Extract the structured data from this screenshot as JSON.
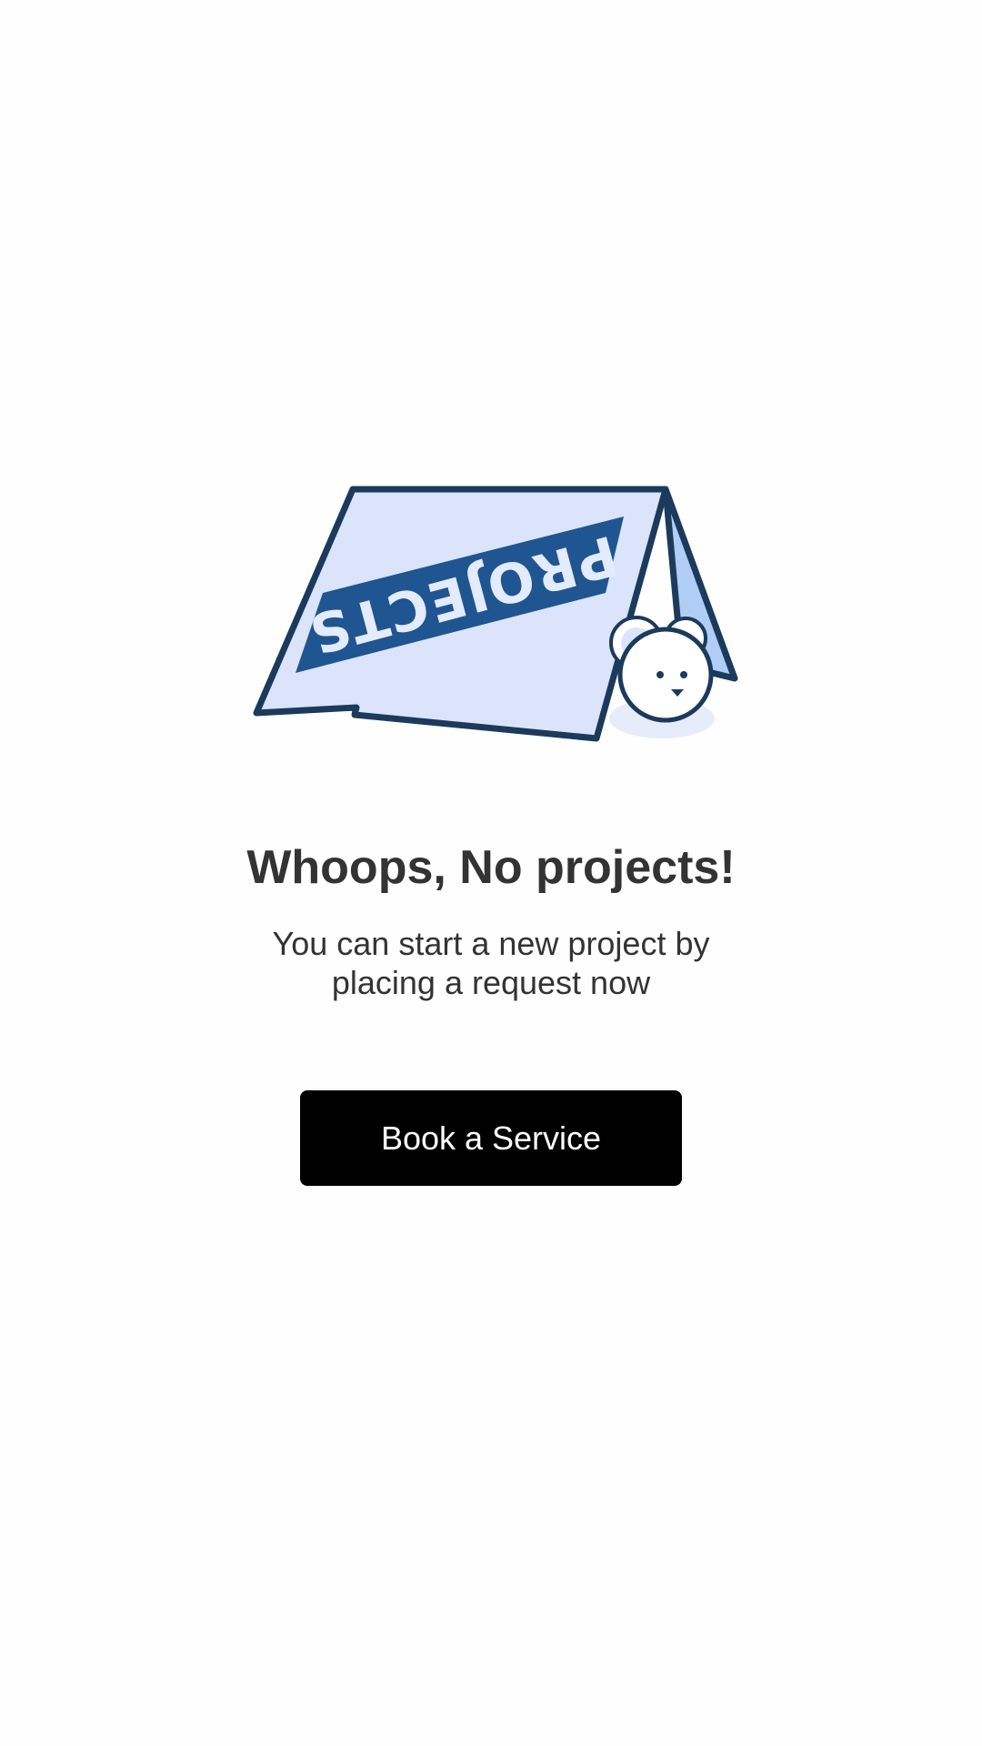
{
  "empty_state": {
    "illustration": {
      "icon": "projects-tent-illustration",
      "sign_text": "PROJECTS",
      "mascot_icon": "mouse-mascot-icon"
    },
    "title": "Whoops, No projects!",
    "subtitle_line1": "You can start a new project by",
    "subtitle_line2": "placing a request now",
    "button_label": "Book a Service"
  },
  "colors": {
    "background": "#fefefe",
    "text": "#333333",
    "button_bg": "#000000",
    "button_text": "#ffffff",
    "illustration_outline": "#1b3a5c",
    "illustration_fill": "#dbe4fb",
    "illustration_band": "#1f5590",
    "illustration_side": "#b0cdf5"
  }
}
